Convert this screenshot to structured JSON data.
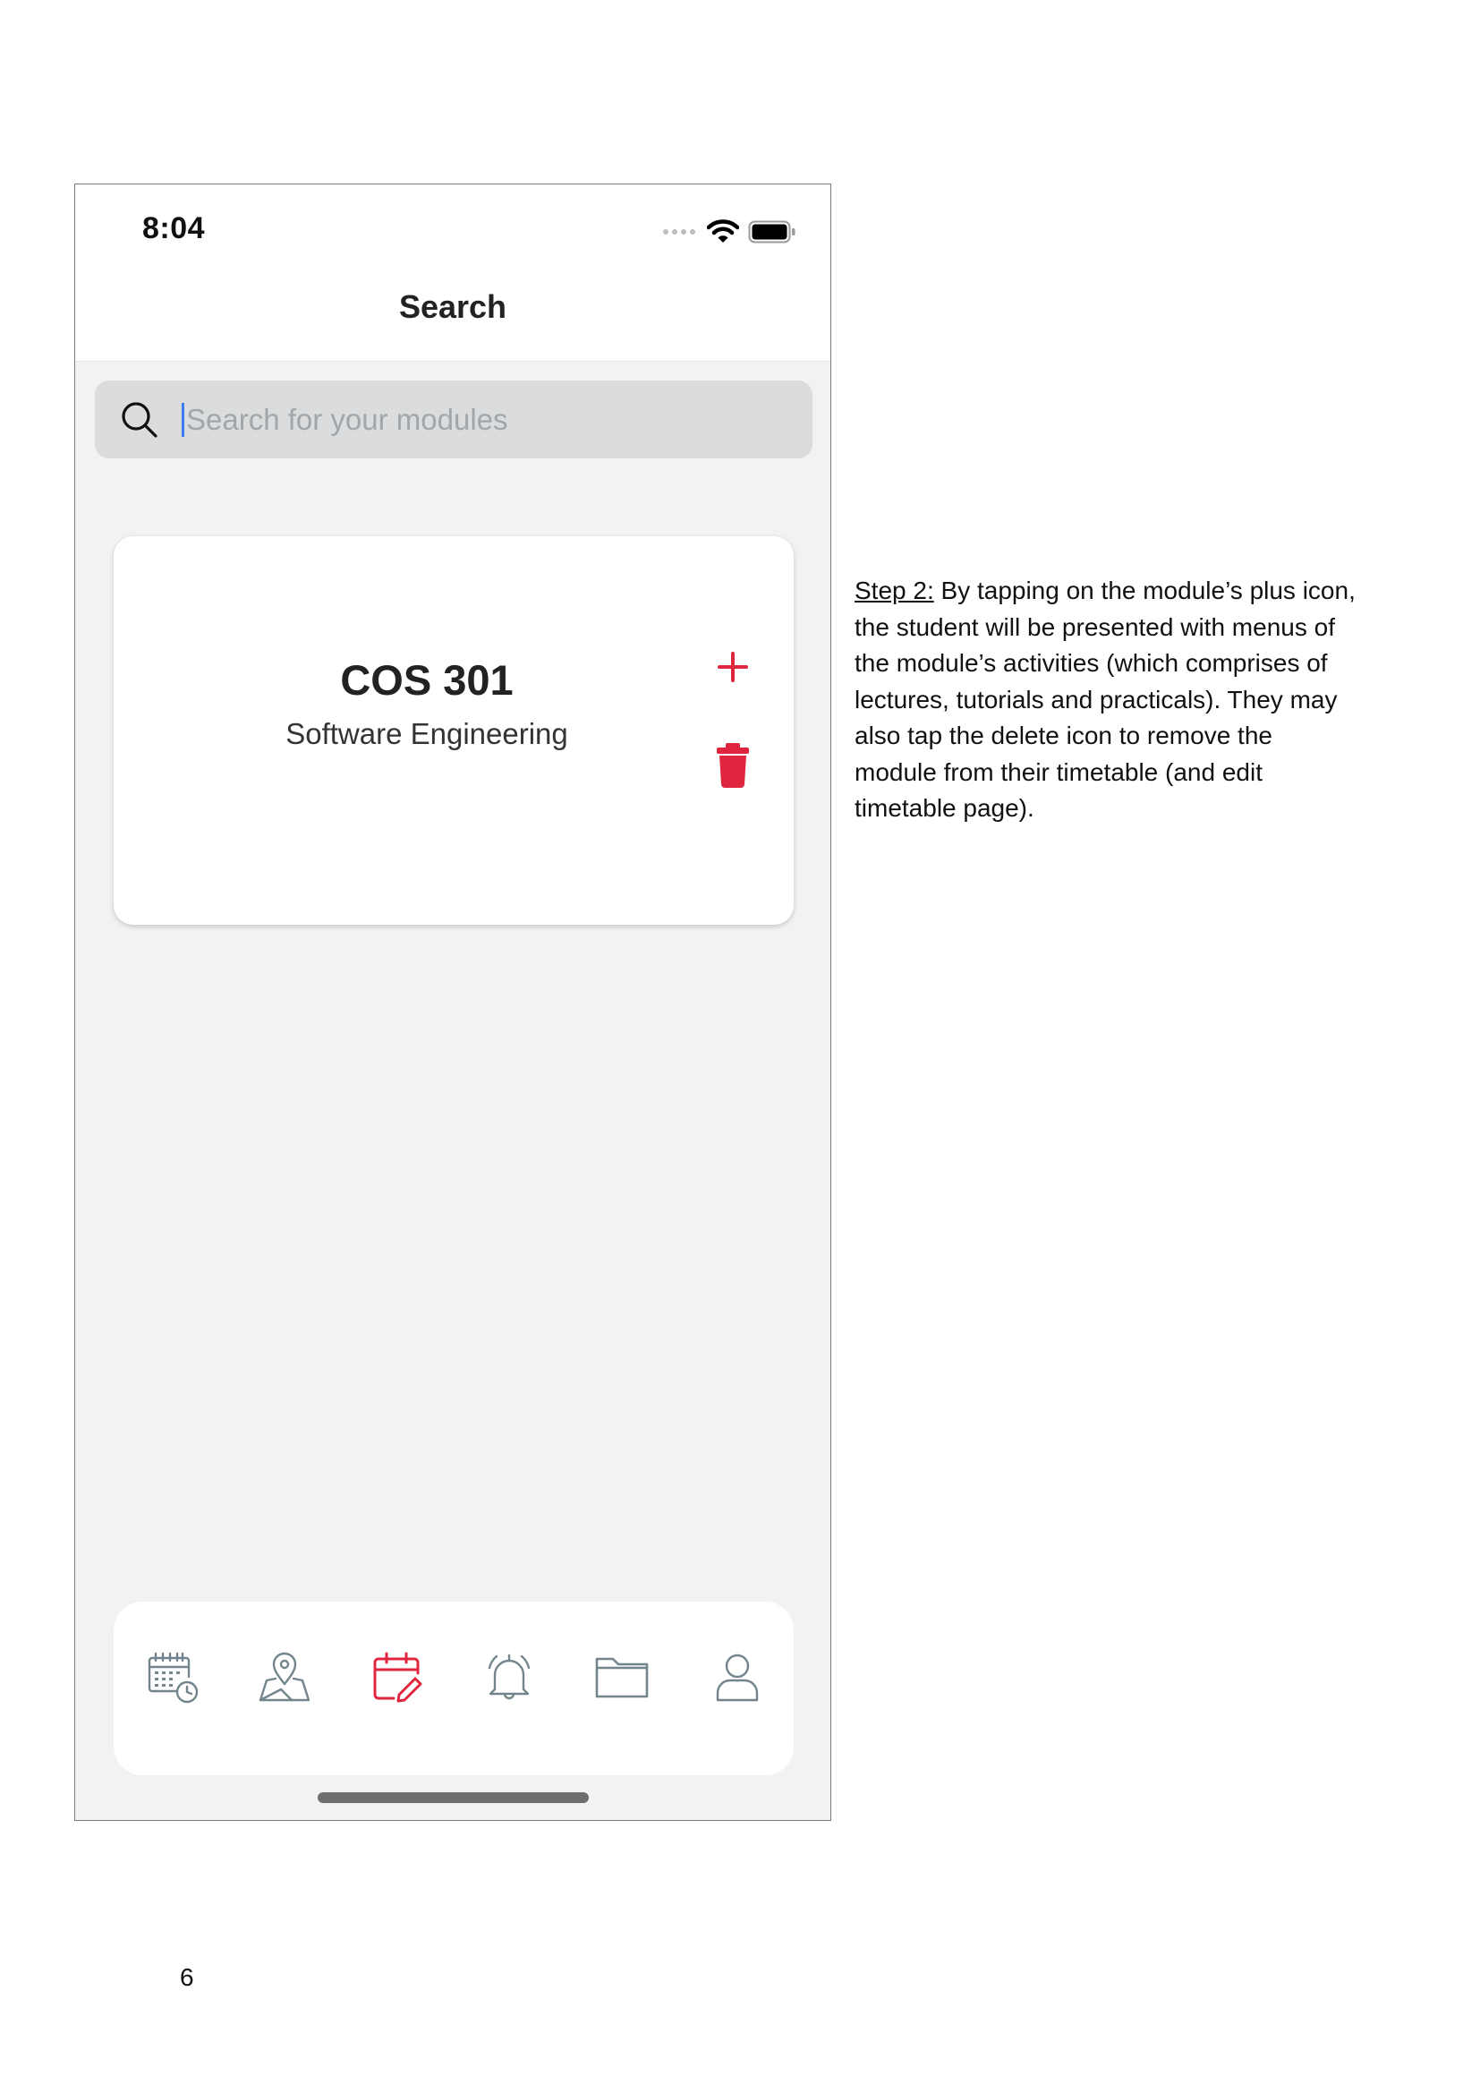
{
  "status_bar": {
    "time": "8:04"
  },
  "nav": {
    "title": "Search"
  },
  "search": {
    "placeholder": "Search for your modules",
    "value": ""
  },
  "module_card": {
    "code": "COS 301",
    "name": "Software Engineering",
    "add_icon": "plus-icon",
    "delete_icon": "trash-icon"
  },
  "tab_bar": {
    "items": [
      {
        "icon": "calendar-clock-icon",
        "active": false
      },
      {
        "icon": "map-pin-icon",
        "active": false
      },
      {
        "icon": "calendar-edit-icon",
        "active": true
      },
      {
        "icon": "bell-icon",
        "active": false
      },
      {
        "icon": "folder-icon",
        "active": false
      },
      {
        "icon": "user-icon",
        "active": false
      }
    ]
  },
  "document": {
    "step_label": "Step 2:",
    "step_body": " By tapping on the module’s plus icon, the student will be presented with menus of the module’s activities (which comprises of lectures, tutorials and practicals). They may also tap the delete icon to remove the module from their timetable (and edit timetable page).",
    "page_number": "6"
  },
  "colors": {
    "accent": "#e0263f",
    "icon_gray": "#73858c",
    "background": "#f2f2f2",
    "search_bg": "#dadcdd"
  }
}
